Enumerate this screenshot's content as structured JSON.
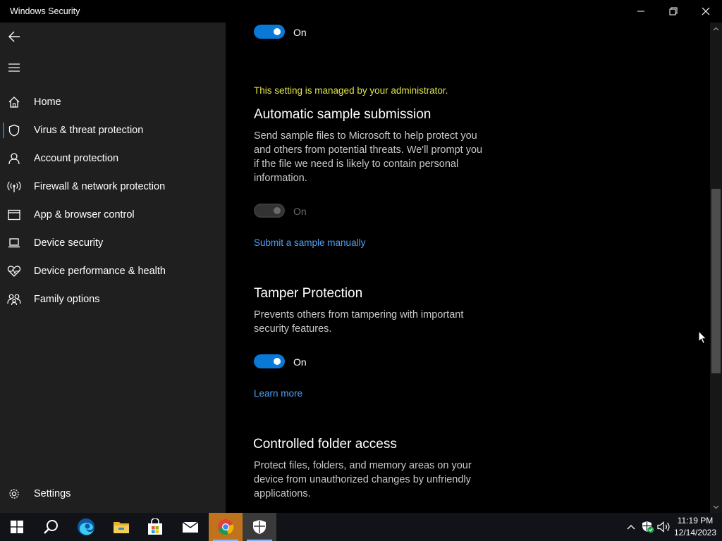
{
  "window": {
    "title": "Windows Security"
  },
  "sidebar": {
    "items": [
      {
        "label": "Home",
        "icon": "home-icon"
      },
      {
        "label": "Virus & threat protection",
        "icon": "shield-icon",
        "selected": true
      },
      {
        "label": "Account protection",
        "icon": "person-icon"
      },
      {
        "label": "Firewall & network protection",
        "icon": "antenna-icon"
      },
      {
        "label": "App & browser control",
        "icon": "browser-window-icon"
      },
      {
        "label": "Device security",
        "icon": "laptop-icon"
      },
      {
        "label": "Device performance & health",
        "icon": "heart-pulse-icon"
      },
      {
        "label": "Family options",
        "icon": "family-icon"
      }
    ],
    "settings_label": "Settings"
  },
  "main": {
    "top_toggle": {
      "state_label": "On",
      "on": true
    },
    "managed_notice": "This setting is managed by your administrator.",
    "sample_submission": {
      "title": "Automatic sample submission",
      "description": "Send sample files to Microsoft to help protect you and others from potential threats. We'll prompt you if the file we need is likely to contain personal information.",
      "toggle": {
        "state_label": "On",
        "on": true,
        "disabled": true
      },
      "link": "Submit a sample manually"
    },
    "tamper_protection": {
      "title": "Tamper Protection",
      "description": "Prevents others from tampering with important security features.",
      "toggle": {
        "state_label": "On",
        "on": true
      },
      "link": "Learn more"
    },
    "controlled_folder_access": {
      "title": "Controlled folder access",
      "description": "Protect files, folders, and memory areas on your device from unauthorized changes by unfriendly applications."
    }
  },
  "taskbar": {
    "apps": [
      "start-icon",
      "search-icon",
      "edge-icon",
      "file-explorer-icon",
      "store-icon",
      "mail-icon",
      "chrome-icon",
      "windows-security-icon"
    ],
    "clock": {
      "time": "11:19 PM",
      "date": "12/14/2023"
    }
  },
  "colors": {
    "accent": "#0a78d7",
    "link": "#4ea1f5",
    "managed": "#e3e347",
    "sidebar_bg": "#1f1f1f"
  }
}
